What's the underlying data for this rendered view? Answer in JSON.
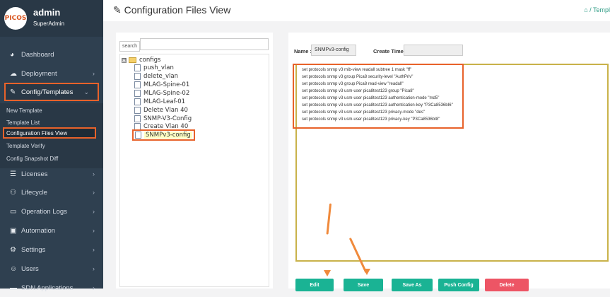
{
  "profile": {
    "logo_text": "PICOS",
    "name": "admin",
    "role": "SuperAdmin"
  },
  "sidebar": {
    "items": [
      {
        "label": "Dashboard",
        "icon": "dashboard-icon",
        "glyph": "◕",
        "chevron": ""
      },
      {
        "label": "Deployment",
        "icon": "cloud-icon",
        "glyph": "☁",
        "chevron": "›"
      },
      {
        "label": "Config/Templates",
        "icon": "edit-icon",
        "glyph": "✎",
        "chevron": "⌄"
      },
      {
        "label": "Licenses",
        "icon": "list-icon",
        "glyph": "☰",
        "chevron": "›"
      },
      {
        "label": "Lifecycle",
        "icon": "sitemap-icon",
        "glyph": "⚇",
        "chevron": "›"
      },
      {
        "label": "Operation Logs",
        "icon": "monitor-icon",
        "glyph": "▭",
        "chevron": "›"
      },
      {
        "label": "Automation",
        "icon": "terminal-icon",
        "glyph": "▣",
        "chevron": "›"
      },
      {
        "label": "Settings",
        "icon": "gears-icon",
        "glyph": "⚙",
        "chevron": "›"
      },
      {
        "label": "Users",
        "icon": "users-icon",
        "glyph": "☺",
        "chevron": "›"
      },
      {
        "label": "SDN Applications",
        "icon": "network-icon",
        "glyph": "▬",
        "chevron": "›"
      }
    ],
    "submenu": [
      {
        "label": "New Template"
      },
      {
        "label": "Template List"
      },
      {
        "label": "Configuration Files View"
      },
      {
        "label": "Template Verify"
      },
      {
        "label": "Config Snapshot Diff"
      }
    ]
  },
  "header": {
    "title_icon": "✎",
    "title": "Configuration Files View",
    "breadcrumb_home": "⌂",
    "breadcrumb": "/ Templ"
  },
  "tree": {
    "search_label": "search",
    "search_placeholder": "",
    "root": {
      "toggle": "⊟",
      "label": "configs"
    },
    "files": [
      {
        "label": "push_vlan"
      },
      {
        "label": "delete_vlan"
      },
      {
        "label": "MLAG-Spine-01"
      },
      {
        "label": "MLAG-Spine-02"
      },
      {
        "label": "MLAG-Leaf-01"
      },
      {
        "label": "Delete Vlan 40"
      },
      {
        "label": "SNMP-V3-Config"
      },
      {
        "label": "Create Vlan 40"
      },
      {
        "label": "SNMPv3-config"
      }
    ]
  },
  "editor": {
    "name_label": "Name :",
    "name_value": "SNMPv3-config",
    "ctime_label": "Create Time :",
    "ctime_value": "",
    "lines": [
      "set protocols snmp v3 mib-view readall subtree 1 mask \"ff\"",
      "set protocols snmp v3 group Pica8 security-level \"AuthPriv\"",
      "set protocols snmp v3 group Pica8 read-view \"readall\"",
      "set protocols snmp v3 usm-user pica8test123 group \"Pica8\"",
      "set protocols snmp v3 usm-user pica8test123 authentication-mode \"md5\"",
      "set protocols snmp v3 usm-user pica8test123 authentication-key \"P3Ca8536bI6\"",
      "set protocols snmp v3 usm-user pica8test123 privacy-mode \"des\"",
      "set protocols snmp v3 usm-user pica8test123 privacy-key \"P3Ca8536bI8\""
    ]
  },
  "buttons": {
    "edit": "Edit",
    "save": "Save",
    "save_as": "Save As",
    "push_config": "Push Config",
    "delete": "Delete"
  },
  "colors": {
    "sidebar": "#2f4050",
    "accent": "#1ab394",
    "danger": "#ed5565",
    "highlight": "#e8622a",
    "arrow": "#f08a3c"
  }
}
